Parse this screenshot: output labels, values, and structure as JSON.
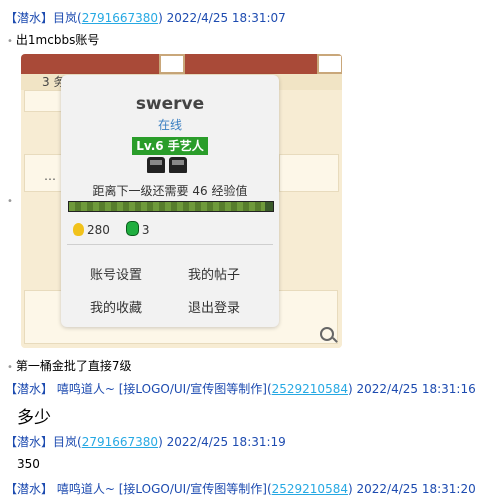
{
  "messages": [
    {
      "group_tag": "【潜水】",
      "nick": "目岚",
      "qq": "2791667380",
      "time": "2022/4/25 18:31:07"
    },
    {
      "group_tag": "【潜水】",
      "nick": "嘻鸣道人~ [接LOGO/UI/宣传图等制作]",
      "qq": "2529210584",
      "time": "2022/4/25 18:31:16"
    },
    {
      "group_tag": "【潜水】",
      "nick": "目岚",
      "qq": "2791667380",
      "time": "2022/4/25 18:31:19"
    },
    {
      "group_tag": "【潜水】",
      "nick": "嘻鸣道人~ [接LOGO/UI/宣传图等制作]",
      "qq": "2529210584",
      "time": "2022/4/25 18:31:20"
    }
  ],
  "texts": {
    "line1": "出1mcbbs账号",
    "line2": "第一桶金批了直接7级",
    "line3": "多少",
    "line4": "350",
    "bullet": "•"
  },
  "card": {
    "username": "swerve",
    "status": "在线",
    "level": "Lv.6 手艺人",
    "need_text": "距离下一级还需要 46 经验值",
    "xp_progress": 0.96,
    "coins": "280",
    "gems": "3",
    "menu": [
      "账号设置",
      "我的帖子",
      "我的收藏",
      "退出登录"
    ]
  },
  "shot_misc": {
    "left_number": "3 务",
    "ellipsis": "…"
  },
  "icons": {
    "coin": "coin-icon",
    "gem": "gem-icon",
    "cart": "minecart-icon",
    "zoom": "zoom-in-icon"
  }
}
